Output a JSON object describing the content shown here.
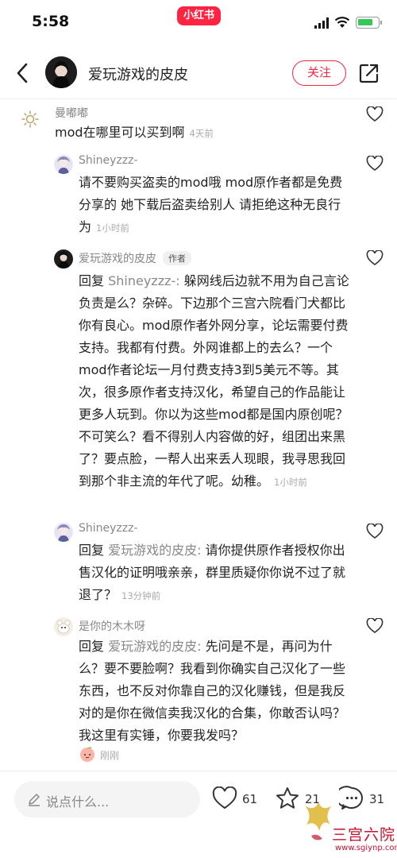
{
  "status_bar": {
    "time": "5:58",
    "app_badge": "小红书"
  },
  "header": {
    "author_name": "爱玩游戏的皮皮",
    "follow_label": "关注"
  },
  "comments": [
    {
      "author": "曼嘟嘟",
      "text": "mod在哪里可以买到啊",
      "time": "4天前"
    },
    {
      "author": "Shineyzzz-",
      "text": "请不要购买盗卖的mod哦 mod原作者都是免费分享的 她下载后盗卖给别人 请拒绝这种无良行为",
      "time": "1小时前"
    },
    {
      "author": "爱玩游戏的皮皮",
      "tag": "作者",
      "reply_prefix": "回复",
      "reply_target": "Shineyzzz-:",
      "text": "躲网线后边就不用为自己言论负责是么？杂碎。下边那个三宫六院看门犬都比你有良心。mod原作者外网分享，论坛需要付费支持。我都有付费。外网谁都上的去么？一个mod作者论坛一月付费支持3到5美元不等。其次，很多原作者支持汉化，希望自己的作品能让更多人玩到。你以为这些mod都是国内原创呢？不可笑么？看不得别人内容做的好，组团出来黑了？要点脸，一帮人出来丢人现眼，我寻思我回到那个非主流的年代了呢。幼稚。",
      "time": "1小时前"
    },
    {
      "author": "Shineyzzz-",
      "reply_prefix": "回复",
      "reply_target": "爱玩游戏的皮皮:",
      "text": "请你提供原作者授权你出售汉化的证明哦亲亲，群里质疑你你说不过了就退了？",
      "time": "13分钟前"
    },
    {
      "author": "是你的木木呀",
      "reply_prefix": "回复",
      "reply_target": "爱玩游戏的皮皮:",
      "text": "先问是不是，再问为什么？要不要脸啊？我看到你确实自己汉化了一些东西，也不反对你靠自己的汉化赚钱，但是我反对的是你在微信卖我汉化的合集，你敢否认吗？我这里有实锤，你要我发吗？",
      "time": "刚刚"
    }
  ],
  "bottom_bar": {
    "input_placeholder": "说点什么...",
    "likes": "61",
    "collects": "21",
    "comments": "31"
  },
  "watermark": {
    "title": "三宫六院",
    "url": "www.sgiynp.com"
  },
  "colors": {
    "accent": "#ff2442",
    "muted_text": "#888888",
    "battery": "#34c759"
  },
  "icons": [
    "back-arrow-icon",
    "share-icon",
    "heart-icon",
    "star-icon",
    "chat-bubble-icon",
    "pen-icon",
    "signal-icon",
    "wifi-icon",
    "battery-icon"
  ]
}
